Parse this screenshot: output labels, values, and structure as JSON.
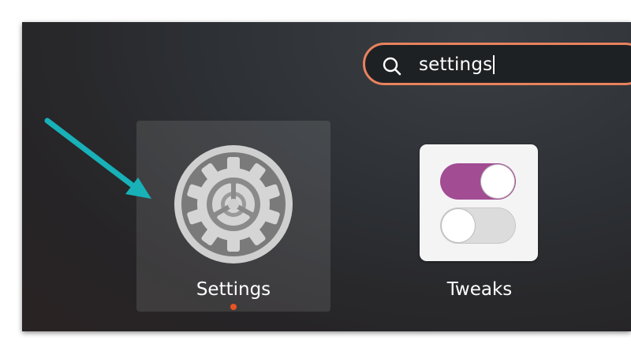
{
  "search": {
    "query": "settings"
  },
  "apps": [
    {
      "label": "Settings",
      "icon": "settings-gear-icon",
      "selected": true,
      "running": true
    },
    {
      "label": "Tweaks",
      "icon": "tweaks-toggle-icon",
      "selected": false,
      "running": false
    }
  ],
  "colors": {
    "search_border": "#e9825e",
    "running_indicator": "#e95420",
    "toggle_on": "#a24c94",
    "annotation_arrow": "#18b1b8"
  }
}
